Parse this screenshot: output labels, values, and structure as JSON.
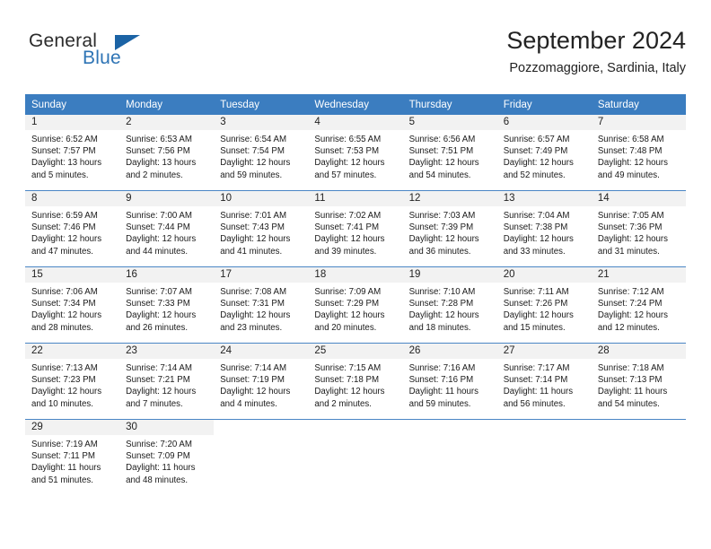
{
  "brand": {
    "name_part1": "General",
    "name_part2": "Blue"
  },
  "header": {
    "title": "September 2024",
    "location": "Pozzomaggiore, Sardinia, Italy"
  },
  "calendar": {
    "weekday_headers": [
      "Sunday",
      "Monday",
      "Tuesday",
      "Wednesday",
      "Thursday",
      "Friday",
      "Saturday"
    ],
    "accent_color": "#3b7dc0",
    "daynum_band_color": "#f2f2f2",
    "weeks": [
      [
        {
          "day": "1",
          "sunrise": "Sunrise: 6:52 AM",
          "sunset": "Sunset: 7:57 PM",
          "daylight1": "Daylight: 13 hours",
          "daylight2": "and 5 minutes."
        },
        {
          "day": "2",
          "sunrise": "Sunrise: 6:53 AM",
          "sunset": "Sunset: 7:56 PM",
          "daylight1": "Daylight: 13 hours",
          "daylight2": "and 2 minutes."
        },
        {
          "day": "3",
          "sunrise": "Sunrise: 6:54 AM",
          "sunset": "Sunset: 7:54 PM",
          "daylight1": "Daylight: 12 hours",
          "daylight2": "and 59 minutes."
        },
        {
          "day": "4",
          "sunrise": "Sunrise: 6:55 AM",
          "sunset": "Sunset: 7:53 PM",
          "daylight1": "Daylight: 12 hours",
          "daylight2": "and 57 minutes."
        },
        {
          "day": "5",
          "sunrise": "Sunrise: 6:56 AM",
          "sunset": "Sunset: 7:51 PM",
          "daylight1": "Daylight: 12 hours",
          "daylight2": "and 54 minutes."
        },
        {
          "day": "6",
          "sunrise": "Sunrise: 6:57 AM",
          "sunset": "Sunset: 7:49 PM",
          "daylight1": "Daylight: 12 hours",
          "daylight2": "and 52 minutes."
        },
        {
          "day": "7",
          "sunrise": "Sunrise: 6:58 AM",
          "sunset": "Sunset: 7:48 PM",
          "daylight1": "Daylight: 12 hours",
          "daylight2": "and 49 minutes."
        }
      ],
      [
        {
          "day": "8",
          "sunrise": "Sunrise: 6:59 AM",
          "sunset": "Sunset: 7:46 PM",
          "daylight1": "Daylight: 12 hours",
          "daylight2": "and 47 minutes."
        },
        {
          "day": "9",
          "sunrise": "Sunrise: 7:00 AM",
          "sunset": "Sunset: 7:44 PM",
          "daylight1": "Daylight: 12 hours",
          "daylight2": "and 44 minutes."
        },
        {
          "day": "10",
          "sunrise": "Sunrise: 7:01 AM",
          "sunset": "Sunset: 7:43 PM",
          "daylight1": "Daylight: 12 hours",
          "daylight2": "and 41 minutes."
        },
        {
          "day": "11",
          "sunrise": "Sunrise: 7:02 AM",
          "sunset": "Sunset: 7:41 PM",
          "daylight1": "Daylight: 12 hours",
          "daylight2": "and 39 minutes."
        },
        {
          "day": "12",
          "sunrise": "Sunrise: 7:03 AM",
          "sunset": "Sunset: 7:39 PM",
          "daylight1": "Daylight: 12 hours",
          "daylight2": "and 36 minutes."
        },
        {
          "day": "13",
          "sunrise": "Sunrise: 7:04 AM",
          "sunset": "Sunset: 7:38 PM",
          "daylight1": "Daylight: 12 hours",
          "daylight2": "and 33 minutes."
        },
        {
          "day": "14",
          "sunrise": "Sunrise: 7:05 AM",
          "sunset": "Sunset: 7:36 PM",
          "daylight1": "Daylight: 12 hours",
          "daylight2": "and 31 minutes."
        }
      ],
      [
        {
          "day": "15",
          "sunrise": "Sunrise: 7:06 AM",
          "sunset": "Sunset: 7:34 PM",
          "daylight1": "Daylight: 12 hours",
          "daylight2": "and 28 minutes."
        },
        {
          "day": "16",
          "sunrise": "Sunrise: 7:07 AM",
          "sunset": "Sunset: 7:33 PM",
          "daylight1": "Daylight: 12 hours",
          "daylight2": "and 26 minutes."
        },
        {
          "day": "17",
          "sunrise": "Sunrise: 7:08 AM",
          "sunset": "Sunset: 7:31 PM",
          "daylight1": "Daylight: 12 hours",
          "daylight2": "and 23 minutes."
        },
        {
          "day": "18",
          "sunrise": "Sunrise: 7:09 AM",
          "sunset": "Sunset: 7:29 PM",
          "daylight1": "Daylight: 12 hours",
          "daylight2": "and 20 minutes."
        },
        {
          "day": "19",
          "sunrise": "Sunrise: 7:10 AM",
          "sunset": "Sunset: 7:28 PM",
          "daylight1": "Daylight: 12 hours",
          "daylight2": "and 18 minutes."
        },
        {
          "day": "20",
          "sunrise": "Sunrise: 7:11 AM",
          "sunset": "Sunset: 7:26 PM",
          "daylight1": "Daylight: 12 hours",
          "daylight2": "and 15 minutes."
        },
        {
          "day": "21",
          "sunrise": "Sunrise: 7:12 AM",
          "sunset": "Sunset: 7:24 PM",
          "daylight1": "Daylight: 12 hours",
          "daylight2": "and 12 minutes."
        }
      ],
      [
        {
          "day": "22",
          "sunrise": "Sunrise: 7:13 AM",
          "sunset": "Sunset: 7:23 PM",
          "daylight1": "Daylight: 12 hours",
          "daylight2": "and 10 minutes."
        },
        {
          "day": "23",
          "sunrise": "Sunrise: 7:14 AM",
          "sunset": "Sunset: 7:21 PM",
          "daylight1": "Daylight: 12 hours",
          "daylight2": "and 7 minutes."
        },
        {
          "day": "24",
          "sunrise": "Sunrise: 7:14 AM",
          "sunset": "Sunset: 7:19 PM",
          "daylight1": "Daylight: 12 hours",
          "daylight2": "and 4 minutes."
        },
        {
          "day": "25",
          "sunrise": "Sunrise: 7:15 AM",
          "sunset": "Sunset: 7:18 PM",
          "daylight1": "Daylight: 12 hours",
          "daylight2": "and 2 minutes."
        },
        {
          "day": "26",
          "sunrise": "Sunrise: 7:16 AM",
          "sunset": "Sunset: 7:16 PM",
          "daylight1": "Daylight: 11 hours",
          "daylight2": "and 59 minutes."
        },
        {
          "day": "27",
          "sunrise": "Sunrise: 7:17 AM",
          "sunset": "Sunset: 7:14 PM",
          "daylight1": "Daylight: 11 hours",
          "daylight2": "and 56 minutes."
        },
        {
          "day": "28",
          "sunrise": "Sunrise: 7:18 AM",
          "sunset": "Sunset: 7:13 PM",
          "daylight1": "Daylight: 11 hours",
          "daylight2": "and 54 minutes."
        }
      ],
      [
        {
          "day": "29",
          "sunrise": "Sunrise: 7:19 AM",
          "sunset": "Sunset: 7:11 PM",
          "daylight1": "Daylight: 11 hours",
          "daylight2": "and 51 minutes."
        },
        {
          "day": "30",
          "sunrise": "Sunrise: 7:20 AM",
          "sunset": "Sunset: 7:09 PM",
          "daylight1": "Daylight: 11 hours",
          "daylight2": "and 48 minutes."
        },
        {
          "day": "",
          "sunrise": "",
          "sunset": "",
          "daylight1": "",
          "daylight2": ""
        },
        {
          "day": "",
          "sunrise": "",
          "sunset": "",
          "daylight1": "",
          "daylight2": ""
        },
        {
          "day": "",
          "sunrise": "",
          "sunset": "",
          "daylight1": "",
          "daylight2": ""
        },
        {
          "day": "",
          "sunrise": "",
          "sunset": "",
          "daylight1": "",
          "daylight2": ""
        },
        {
          "day": "",
          "sunrise": "",
          "sunset": "",
          "daylight1": "",
          "daylight2": ""
        }
      ]
    ]
  }
}
